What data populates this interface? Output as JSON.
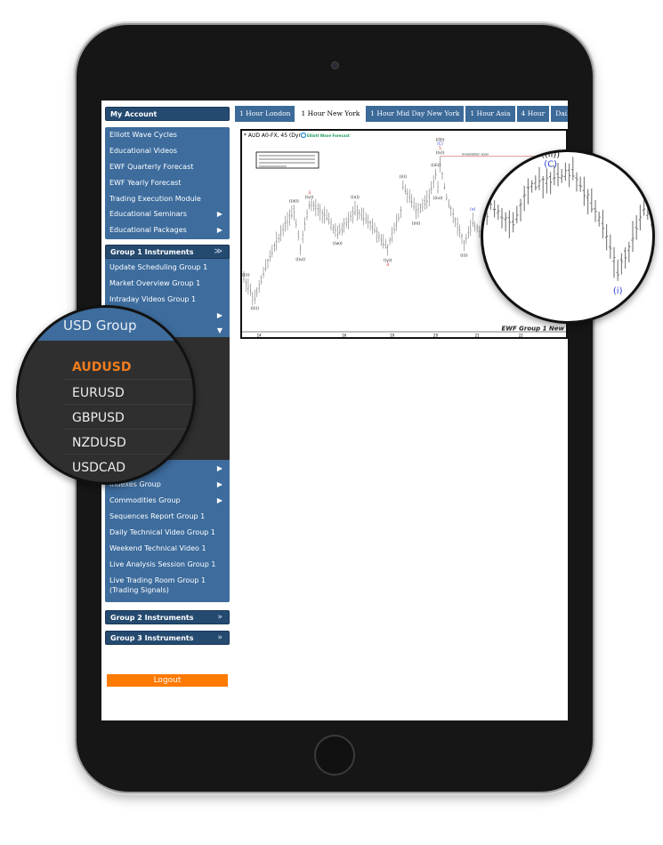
{
  "sidebar": {
    "my_account": "My Account",
    "block1": [
      "Elliott Wave Cycles",
      "Educational Videos",
      "EWF Quarterly Forecast",
      "EWF Yearly Forecast",
      "Trading Execution Module",
      "Educational Seminars",
      "Educational Packages"
    ],
    "group1": {
      "title": "Group 1 Instruments",
      "items": [
        "Update Scheduling Group 1",
        "Market Overview Group 1",
        "Intraday Videos Group 1"
      ],
      "lower_items": [
        "Indexes Group",
        "Commodities Group",
        "Sequences Report Group 1",
        "Daily Technical Video Group 1",
        "Weekend Technical Video 1",
        "Live Analysis Session Group 1",
        "Live Trading Room Group 1",
        "(Trading Signals)"
      ]
    },
    "group2": "Group 2 Instruments",
    "group3": "Group 3 Instruments",
    "logout": "Logout"
  },
  "dropdown": {
    "title": "USD Group",
    "items": [
      "AUDUSD",
      "EURUSD",
      "GBPUSD",
      "NZDUSD",
      "USDCAD"
    ],
    "selected": "AUDUSD",
    "selected_color": "#f07c1e"
  },
  "tabs": [
    "1 Hour London",
    "1 Hour New York",
    "1 Hour Mid Day New York",
    "1 Hour Asia",
    "4 Hour",
    "Daily",
    "W"
  ],
  "active_tab": "1 Hour New York",
  "colors": {
    "nav_blue": "#3d6c9d",
    "nav_dark": "#254a70",
    "logout": "#ff7a00",
    "wave_red": "#d32020",
    "wave_blue": "#2a3fd0"
  },
  "chart_data": {
    "type": "ohlc-bars",
    "title": "* AUD A0-FX, 45 (Dyn",
    "brand": "Elliott Wave Forecast",
    "invalidation_label": "Invalidation level",
    "footer": "EWF Group 1 New",
    "x_ticks": [
      {
        "label": "14",
        "i": 7
      },
      {
        "label": "16",
        "i": 46
      },
      {
        "label": "19",
        "i": 68
      },
      {
        "label": "20",
        "i": 88
      },
      {
        "label": "21",
        "i": 107
      },
      {
        "label": "22",
        "i": 127
      }
    ],
    "path": [
      [
        0,
        55
      ],
      [
        5,
        30
      ],
      [
        11,
        75
      ],
      [
        19,
        120
      ],
      [
        23,
        135
      ],
      [
        26,
        92
      ],
      [
        30,
        143
      ],
      [
        37,
        130
      ],
      [
        43,
        107
      ],
      [
        51,
        135
      ],
      [
        59,
        117
      ],
      [
        66,
        90
      ],
      [
        72,
        135
      ],
      [
        73,
        165
      ],
      [
        79,
        135
      ],
      [
        85,
        150
      ],
      [
        88,
        180
      ],
      [
        89,
        160
      ],
      [
        90,
        190
      ],
      [
        93,
        150
      ],
      [
        99,
        110
      ],
      [
        101,
        95
      ],
      [
        105,
        120
      ],
      [
        111,
        105
      ],
      [
        115,
        130
      ],
      [
        121,
        138
      ],
      [
        127,
        142
      ],
      [
        135,
        105
      ],
      [
        139,
        72
      ],
      [
        142,
        90
      ],
      [
        146,
        117
      ],
      [
        148,
        112
      ],
      [
        149,
        80
      ]
    ],
    "waves": [
      {
        "text": "((i))",
        "i": 1,
        "pos": "above",
        "color": "black"
      },
      {
        "text": "((ii))",
        "i": 5,
        "pos": "below",
        "color": "black"
      },
      {
        "text": "((iii))",
        "i": 23,
        "pos": "above",
        "color": "black"
      },
      {
        "text": "((iv))",
        "i": 26,
        "pos": "below",
        "color": "black"
      },
      {
        "text": "((v))",
        "i": 30,
        "pos": "above",
        "color": "black"
      },
      {
        "text": "3",
        "i": 30,
        "pos": "above2",
        "color": "red"
      },
      {
        "text": "((w))",
        "i": 43,
        "pos": "below",
        "color": "black"
      },
      {
        "text": "((x))",
        "i": 51,
        "pos": "above",
        "color": "black"
      },
      {
        "text": "((y))",
        "i": 66,
        "pos": "below",
        "color": "black"
      },
      {
        "text": "4",
        "i": 66,
        "pos": "below2",
        "color": "red"
      },
      {
        "text": "((i))",
        "i": 73,
        "pos": "above",
        "color": "black"
      },
      {
        "text": "((ii))",
        "i": 79,
        "pos": "below",
        "color": "black"
      },
      {
        "text": "((iii))",
        "i": 88,
        "pos": "above",
        "color": "black"
      },
      {
        "text": "((iv))",
        "i": 89,
        "pos": "below",
        "color": "black"
      },
      {
        "text": "((v))",
        "i": 90,
        "pos": "above",
        "color": "black"
      },
      {
        "text": "5",
        "i": 90,
        "pos": "above2",
        "color": "red"
      },
      {
        "text": "(C)",
        "i": 90,
        "pos": "above3",
        "color": "blue"
      },
      {
        "text": "((X))",
        "i": 90,
        "pos": "above4",
        "color": "black"
      },
      {
        "text": "((i))",
        "i": 101,
        "pos": "below",
        "color": "black"
      },
      {
        "text": "(a)",
        "i": 105,
        "pos": "above",
        "color": "blue"
      }
    ],
    "zoom_waves": [
      {
        "text": "((ii))",
        "i": 121,
        "pos": "above2",
        "color": "black"
      },
      {
        "text": "(C)",
        "i": 121,
        "pos": "above",
        "color": "blue"
      },
      {
        "text": "(i)",
        "i": 139,
        "pos": "below",
        "color": "blue"
      },
      {
        "text": "(ii)",
        "i": 146,
        "pos": "above",
        "color": "blue"
      }
    ]
  }
}
